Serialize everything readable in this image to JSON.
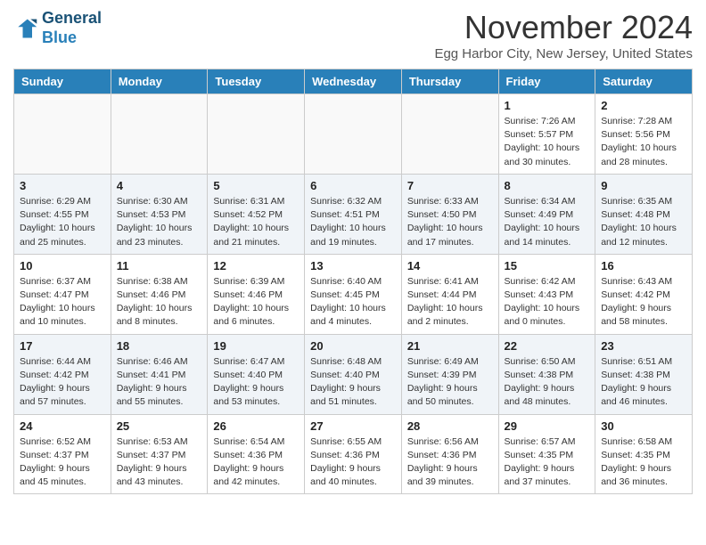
{
  "header": {
    "logo_line1": "General",
    "logo_line2": "Blue",
    "month_title": "November 2024",
    "location": "Egg Harbor City, New Jersey, United States"
  },
  "columns": [
    "Sunday",
    "Monday",
    "Tuesday",
    "Wednesday",
    "Thursday",
    "Friday",
    "Saturday"
  ],
  "weeks": [
    [
      {
        "day": "",
        "info": ""
      },
      {
        "day": "",
        "info": ""
      },
      {
        "day": "",
        "info": ""
      },
      {
        "day": "",
        "info": ""
      },
      {
        "day": "",
        "info": ""
      },
      {
        "day": "1",
        "info": "Sunrise: 7:26 AM\nSunset: 5:57 PM\nDaylight: 10 hours and 30 minutes."
      },
      {
        "day": "2",
        "info": "Sunrise: 7:28 AM\nSunset: 5:56 PM\nDaylight: 10 hours and 28 minutes."
      }
    ],
    [
      {
        "day": "3",
        "info": "Sunrise: 6:29 AM\nSunset: 4:55 PM\nDaylight: 10 hours and 25 minutes."
      },
      {
        "day": "4",
        "info": "Sunrise: 6:30 AM\nSunset: 4:53 PM\nDaylight: 10 hours and 23 minutes."
      },
      {
        "day": "5",
        "info": "Sunrise: 6:31 AM\nSunset: 4:52 PM\nDaylight: 10 hours and 21 minutes."
      },
      {
        "day": "6",
        "info": "Sunrise: 6:32 AM\nSunset: 4:51 PM\nDaylight: 10 hours and 19 minutes."
      },
      {
        "day": "7",
        "info": "Sunrise: 6:33 AM\nSunset: 4:50 PM\nDaylight: 10 hours and 17 minutes."
      },
      {
        "day": "8",
        "info": "Sunrise: 6:34 AM\nSunset: 4:49 PM\nDaylight: 10 hours and 14 minutes."
      },
      {
        "day": "9",
        "info": "Sunrise: 6:35 AM\nSunset: 4:48 PM\nDaylight: 10 hours and 12 minutes."
      }
    ],
    [
      {
        "day": "10",
        "info": "Sunrise: 6:37 AM\nSunset: 4:47 PM\nDaylight: 10 hours and 10 minutes."
      },
      {
        "day": "11",
        "info": "Sunrise: 6:38 AM\nSunset: 4:46 PM\nDaylight: 10 hours and 8 minutes."
      },
      {
        "day": "12",
        "info": "Sunrise: 6:39 AM\nSunset: 4:46 PM\nDaylight: 10 hours and 6 minutes."
      },
      {
        "day": "13",
        "info": "Sunrise: 6:40 AM\nSunset: 4:45 PM\nDaylight: 10 hours and 4 minutes."
      },
      {
        "day": "14",
        "info": "Sunrise: 6:41 AM\nSunset: 4:44 PM\nDaylight: 10 hours and 2 minutes."
      },
      {
        "day": "15",
        "info": "Sunrise: 6:42 AM\nSunset: 4:43 PM\nDaylight: 10 hours and 0 minutes."
      },
      {
        "day": "16",
        "info": "Sunrise: 6:43 AM\nSunset: 4:42 PM\nDaylight: 9 hours and 58 minutes."
      }
    ],
    [
      {
        "day": "17",
        "info": "Sunrise: 6:44 AM\nSunset: 4:42 PM\nDaylight: 9 hours and 57 minutes."
      },
      {
        "day": "18",
        "info": "Sunrise: 6:46 AM\nSunset: 4:41 PM\nDaylight: 9 hours and 55 minutes."
      },
      {
        "day": "19",
        "info": "Sunrise: 6:47 AM\nSunset: 4:40 PM\nDaylight: 9 hours and 53 minutes."
      },
      {
        "day": "20",
        "info": "Sunrise: 6:48 AM\nSunset: 4:40 PM\nDaylight: 9 hours and 51 minutes."
      },
      {
        "day": "21",
        "info": "Sunrise: 6:49 AM\nSunset: 4:39 PM\nDaylight: 9 hours and 50 minutes."
      },
      {
        "day": "22",
        "info": "Sunrise: 6:50 AM\nSunset: 4:38 PM\nDaylight: 9 hours and 48 minutes."
      },
      {
        "day": "23",
        "info": "Sunrise: 6:51 AM\nSunset: 4:38 PM\nDaylight: 9 hours and 46 minutes."
      }
    ],
    [
      {
        "day": "24",
        "info": "Sunrise: 6:52 AM\nSunset: 4:37 PM\nDaylight: 9 hours and 45 minutes."
      },
      {
        "day": "25",
        "info": "Sunrise: 6:53 AM\nSunset: 4:37 PM\nDaylight: 9 hours and 43 minutes."
      },
      {
        "day": "26",
        "info": "Sunrise: 6:54 AM\nSunset: 4:36 PM\nDaylight: 9 hours and 42 minutes."
      },
      {
        "day": "27",
        "info": "Sunrise: 6:55 AM\nSunset: 4:36 PM\nDaylight: 9 hours and 40 minutes."
      },
      {
        "day": "28",
        "info": "Sunrise: 6:56 AM\nSunset: 4:36 PM\nDaylight: 9 hours and 39 minutes."
      },
      {
        "day": "29",
        "info": "Sunrise: 6:57 AM\nSunset: 4:35 PM\nDaylight: 9 hours and 37 minutes."
      },
      {
        "day": "30",
        "info": "Sunrise: 6:58 AM\nSunset: 4:35 PM\nDaylight: 9 hours and 36 minutes."
      }
    ]
  ]
}
